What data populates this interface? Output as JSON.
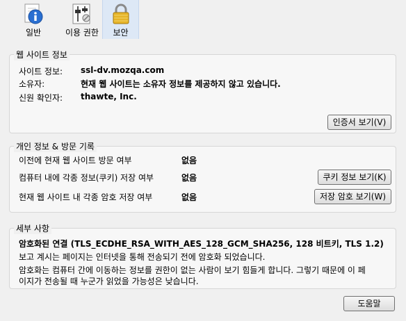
{
  "tabs": [
    {
      "label": "일반"
    },
    {
      "label": "이용 권한"
    },
    {
      "label": "보안"
    }
  ],
  "website": {
    "title": "웹 사이트 정보",
    "site_label": "사이트 정보:",
    "site_value": "ssl-dv.mozqa.com",
    "owner_label": "소유자:",
    "owner_value": "현재 웹 사이트는 소유자 정보를 제공하지 않고 있습니다.",
    "verifier_label": "신원 확인자:",
    "verifier_value": "thawte, Inc.",
    "view_cert_button": "인증서 보기(V)"
  },
  "privacy": {
    "title": "개인 정보 & 방문 기록",
    "visited_label": "이전에 현재 웹 사이트 방문 여부",
    "visited_value": "없음",
    "cookies_label": "컴퓨터 내에 각종 정보(쿠키) 저장 여부",
    "cookies_value": "없음",
    "cookies_button": "쿠키 정보 보기(K)",
    "passwords_label": "현재 웹 사이트 내 각종 암호 저장 여부",
    "passwords_value": "없음",
    "passwords_button": "저장 암호 보기(W)"
  },
  "details": {
    "title": "세부 사항",
    "conn_heading": "암호화된 연결 (TLS_ECDHE_RSA_WITH_AES_128_GCM_SHA256, 128 비트키, TLS 1.2)",
    "line1": "보고 계시는 페이지는 인터넷을 통해 전송되기 전에 암호화 되었습니다.",
    "line2": "암호화는 컴퓨터 간에 이동하는 정보를 권한이 없는 사람이 보기 힘들게 합니다. 그렇기 때문에 이 페",
    "line3": "이지가 전송될 때 누군가 읽었을 가능성은 낮습니다."
  },
  "help_button": "도움말",
  "colors": {
    "selected_tab": "#dde8f6",
    "info_icon": "#2a6fd1",
    "lock_icon": "#d9a520"
  },
  "icons": {
    "general": "info-icon",
    "permissions": "permissions-icon",
    "security": "lock-icon"
  }
}
